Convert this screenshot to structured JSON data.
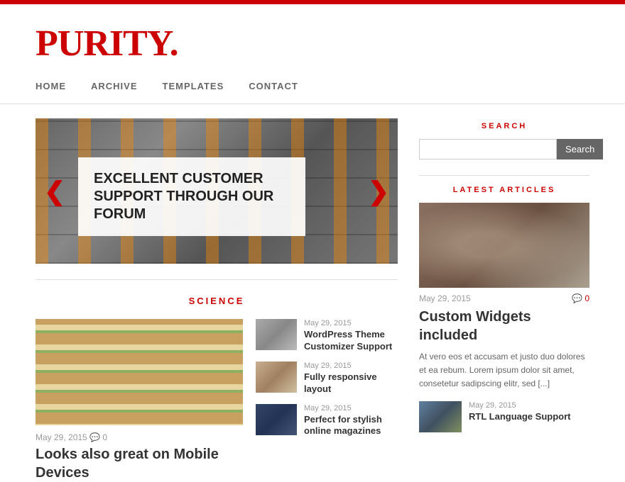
{
  "topbar": {},
  "header": {
    "logo_text": "PURITY",
    "logo_dot": "."
  },
  "nav": {
    "items": [
      {
        "label": "HOME",
        "href": "#"
      },
      {
        "label": "ARCHIVE",
        "href": "#"
      },
      {
        "label": "TEMPLATES",
        "href": "#"
      },
      {
        "label": "CONTACT",
        "href": "#"
      }
    ]
  },
  "hero": {
    "caption": "EXCELLENT CUSTOMER SUPPORT THROUGH OUR FORUM"
  },
  "science_section": {
    "title": "SCIENCE"
  },
  "main_article": {
    "date": "May 29, 2015",
    "comments": "0",
    "title": "Looks also great on Mobile Devices"
  },
  "small_articles": [
    {
      "date": "May 29, 2015",
      "title": "WordPress Theme Customizer Support"
    },
    {
      "date": "May 29, 2015",
      "title": "Fully responsive layout"
    },
    {
      "date": "May 29, 2015",
      "title": "Perfect for stylish online magazines"
    }
  ],
  "sidebar": {
    "search_title": "SEARCH",
    "search_placeholder": "",
    "search_button": "Search",
    "latest_title": "LATEST ARTICLES",
    "featured_article": {
      "date": "May 29, 2015",
      "comments": "0",
      "title": "Custom Widgets included",
      "excerpt": "At vero eos et accusam et justo duo dolores et ea rebum. Lorem ipsum dolor sit amet, consetetur sadipscing elitr, sed [...]"
    },
    "small_article": {
      "date": "May 29, 2015",
      "title": "RTL Language Support"
    }
  }
}
